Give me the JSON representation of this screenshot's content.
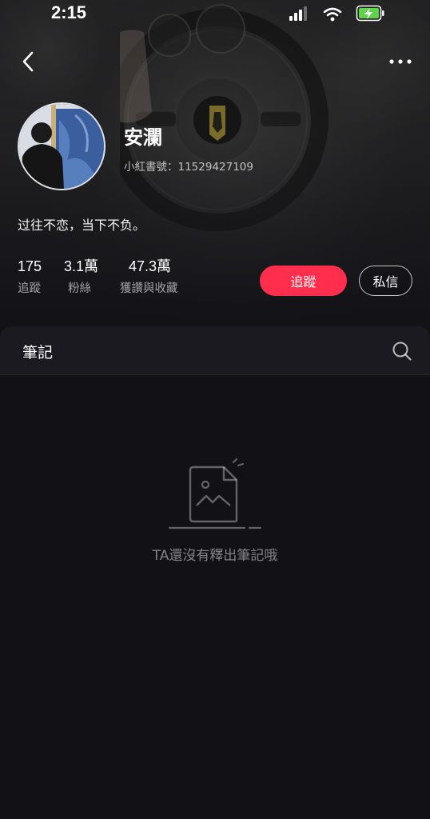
{
  "status_bar": {
    "time": "2:15"
  },
  "profile": {
    "name": "安瀾",
    "id_text": "小紅書號：11529427109",
    "bio": "过往不恋，当下不负。"
  },
  "stats": [
    {
      "value": "175",
      "label": "追蹤"
    },
    {
      "value": "3.1萬",
      "label": "粉絲"
    },
    {
      "value": "47.3萬",
      "label": "獲讚與收藏"
    }
  ],
  "actions": {
    "follow_label": "追蹤",
    "message_label": "私信"
  },
  "notes": {
    "tab_label": "筆記",
    "empty_text": "TA還沒有釋出筆記哦"
  },
  "colors": {
    "accent": "#ff2e4d",
    "background": "#111116",
    "battery": "#5fd34a"
  },
  "icons": {
    "back": "chevron-left-icon",
    "more": "more-dots-icon",
    "search": "search-icon",
    "empty": "empty-note-icon"
  }
}
